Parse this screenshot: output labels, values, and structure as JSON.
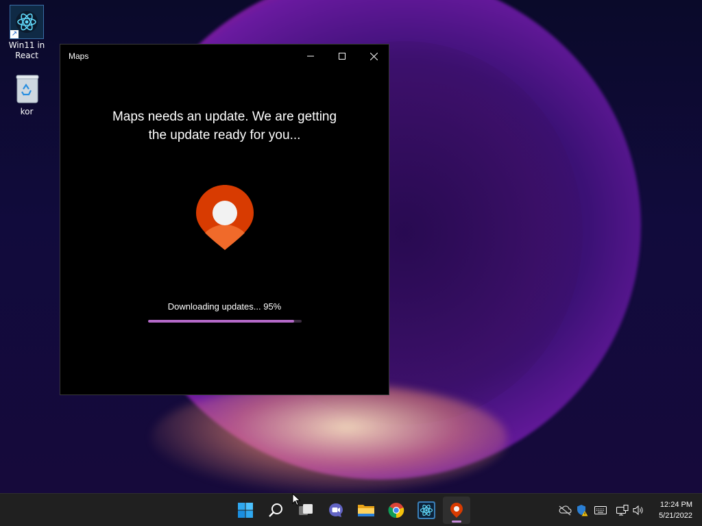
{
  "desktop": {
    "icons": [
      {
        "label": "Win11 in React",
        "icon": "react-icon"
      },
      {
        "label": "kor",
        "icon": "recycle-bin-icon"
      }
    ]
  },
  "window": {
    "title": "Maps",
    "headline_line1": "Maps needs an update. We are getting",
    "headline_line2": "the update ready for you...",
    "progress_label": "Downloading updates... 95%",
    "progress_percent": 95,
    "colors": {
      "accent": "#b469c8",
      "logo_red": "#d83b01"
    }
  },
  "taskbar": {
    "apps": [
      "start-icon",
      "search-icon",
      "task-view-icon",
      "teams-icon",
      "file-explorer-icon",
      "chrome-icon",
      "react-app-icon",
      "maps-icon"
    ],
    "active_app": "maps-icon",
    "tray": [
      "onedrive-icon",
      "defender-icon",
      "keyboard-icon",
      "network-icon",
      "volume-icon"
    ],
    "time": "12:24 PM",
    "date": "5/21/2022"
  }
}
